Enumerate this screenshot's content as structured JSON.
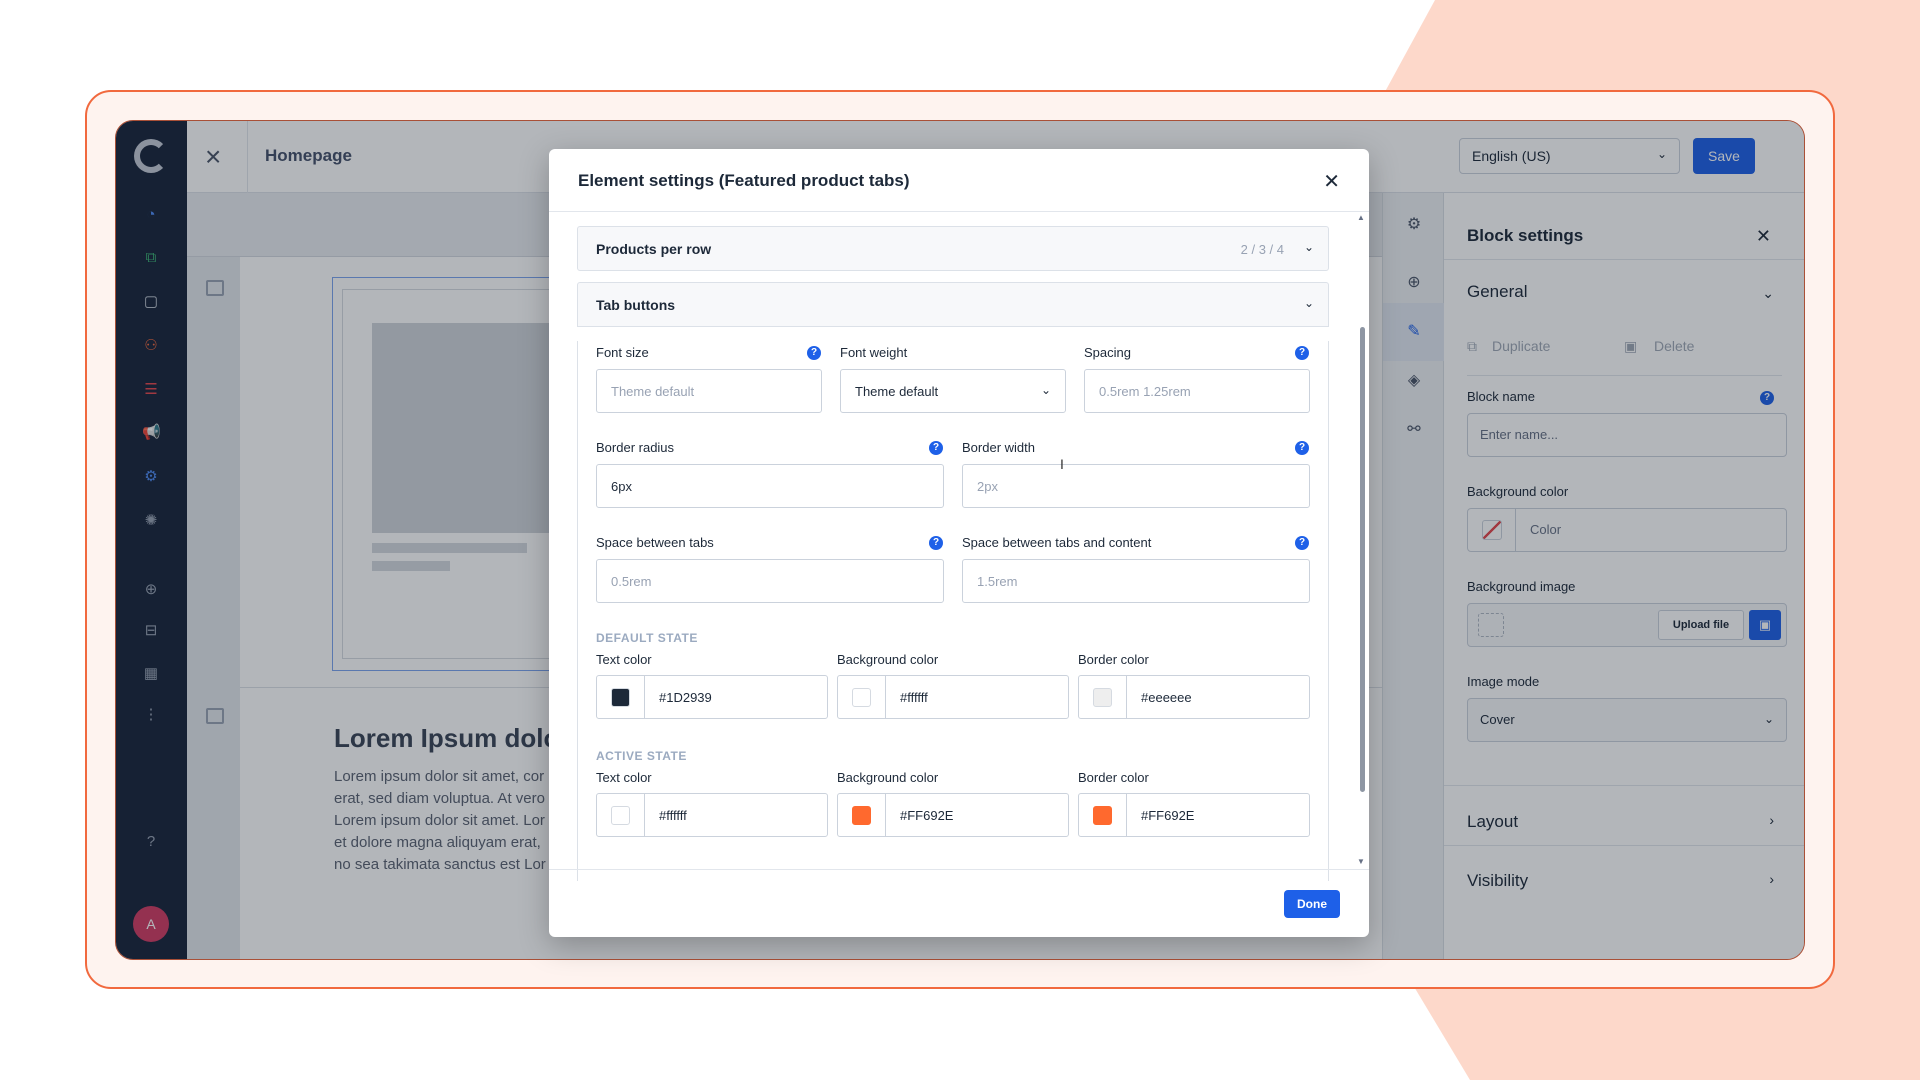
{
  "topbar": {
    "title": "Homepage",
    "language": "English (US)",
    "save_label": "Save"
  },
  "canvas": {
    "lorem_title": "Lorem Ipsum dolo",
    "lorem_lines": [
      "Lorem ipsum dolor sit amet, cor",
      "erat, sed diam voluptua. At vero",
      "Lorem ipsum dolor sit amet. Lor",
      "et dolore magna aliquyam erat,",
      "no sea takimata sanctus est Lor"
    ]
  },
  "rail": {
    "avatar_initial": "A"
  },
  "block_settings": {
    "title": "Block settings",
    "general_label": "General",
    "duplicate_label": "Duplicate",
    "delete_label": "Delete",
    "block_name_label": "Block name",
    "block_name_placeholder": "Enter name...",
    "bg_color_label": "Background color",
    "bg_color_placeholder": "Color",
    "bg_image_label": "Background image",
    "upload_label": "Upload file",
    "image_mode_label": "Image mode",
    "image_mode_value": "Cover",
    "layout_label": "Layout",
    "visibility_label": "Visibility"
  },
  "modal": {
    "title": "Element settings (Featured product tabs)",
    "done_label": "Done",
    "products_per_row": {
      "label": "Products per row",
      "meta": "2 / 3 / 4"
    },
    "tab_buttons": {
      "label": "Tab buttons",
      "font_size": {
        "label": "Font size",
        "placeholder": "Theme default"
      },
      "font_weight": {
        "label": "Font weight",
        "value": "Theme default"
      },
      "spacing": {
        "label": "Spacing",
        "placeholder": "0.5rem 1.25rem"
      },
      "border_radius": {
        "label": "Border radius",
        "value": "6px"
      },
      "border_width": {
        "label": "Border width",
        "placeholder": "2px"
      },
      "space_between_tabs": {
        "label": "Space between tabs",
        "placeholder": "0.5rem"
      },
      "space_between_content": {
        "label": "Space between tabs and content",
        "placeholder": "1.5rem"
      },
      "default_state": {
        "title": "DEFAULT STATE",
        "text_color": {
          "label": "Text color",
          "value": "#1D2939"
        },
        "background_color": {
          "label": "Background color",
          "value": "#ffffff"
        },
        "border_color": {
          "label": "Border color",
          "value": "#eeeeee"
        }
      },
      "active_state": {
        "title": "ACTIVE STATE",
        "text_color": {
          "label": "Text color",
          "value": "#ffffff"
        },
        "background_color": {
          "label": "Background color",
          "value": "#FF692E"
        },
        "border_color": {
          "label": "Border color",
          "value": "#FF692E"
        }
      }
    }
  },
  "colors": {
    "accent": "#1E60E8",
    "brand_orange": "#F1693E",
    "rail_bg": "#18243A"
  }
}
